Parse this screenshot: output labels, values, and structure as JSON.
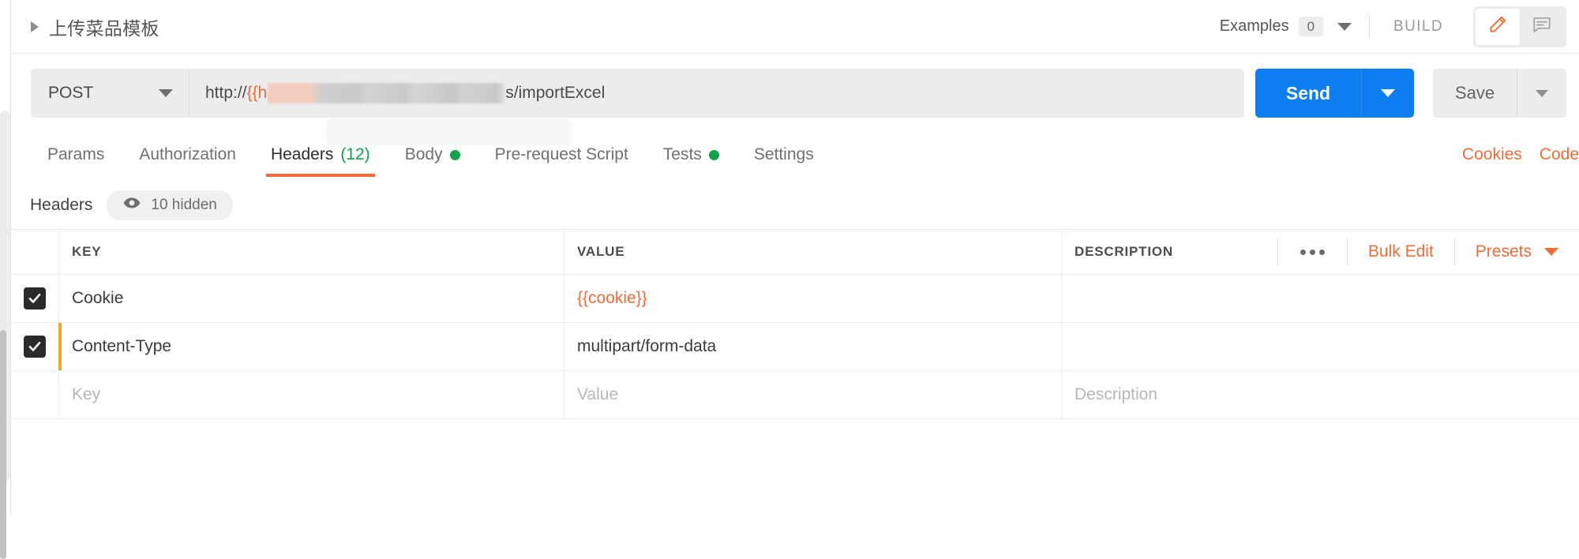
{
  "header": {
    "request_title": "上传菜品模板",
    "collapse_icon": "triangle-right-icon",
    "examples_label": "Examples",
    "examples_count": "0",
    "examples_caret_icon": "chevron-down-icon",
    "build_label": "BUILD",
    "edit_icon": "pencil-icon",
    "comment_icon": "comment-icon",
    "accent_color": "#f06c37"
  },
  "url_bar": {
    "method": "POST",
    "method_caret_icon": "chevron-down-icon",
    "url_prefix": "http://",
    "url_variable_open": "{{h",
    "url_redacted": "",
    "url_suffix": "s/importExcel",
    "send_label": "Send",
    "send_caret_icon": "chevron-down-icon",
    "send_color": "#0d7ef0",
    "save_label": "Save",
    "save_caret_icon": "chevron-down-icon"
  },
  "tabs": [
    {
      "label": "Params",
      "active": false,
      "count": "",
      "dot": false
    },
    {
      "label": "Authorization",
      "active": false,
      "count": "",
      "dot": false
    },
    {
      "label": "Headers",
      "active": true,
      "count": "(12)",
      "dot": false
    },
    {
      "label": "Body",
      "active": false,
      "count": "",
      "dot": true
    },
    {
      "label": "Pre-request Script",
      "active": false,
      "count": "",
      "dot": false
    },
    {
      "label": "Tests",
      "active": false,
      "count": "",
      "dot": true
    },
    {
      "label": "Settings",
      "active": false,
      "count": "",
      "dot": false
    }
  ],
  "tab_right_links": [
    {
      "label": "Cookies"
    },
    {
      "label": "Code"
    }
  ],
  "headers_section": {
    "title": "Headers",
    "eye_icon": "eye-icon",
    "hidden_label": "10 hidden"
  },
  "table": {
    "columns": {
      "key": "KEY",
      "value": "VALUE",
      "description": "DESCRIPTION"
    },
    "actions": {
      "more_icon": "ellipsis-icon",
      "bulk_edit": "Bulk Edit",
      "presets": "Presets",
      "presets_caret_icon": "chevron-down-icon"
    },
    "rows": [
      {
        "checked": true,
        "key": "Cookie",
        "value": "{{cookie}}",
        "value_is_variable": true,
        "description": "",
        "marker": false
      },
      {
        "checked": true,
        "key": "Content-Type",
        "value": "multipart/form-data",
        "value_is_variable": false,
        "description": "",
        "marker": true,
        "marker_color": "#f5a623"
      }
    ],
    "empty_row": {
      "key_placeholder": "Key",
      "value_placeholder": "Value",
      "description_placeholder": "Description"
    }
  },
  "scrollbar": {
    "orientation": "vertical",
    "position": "left"
  }
}
